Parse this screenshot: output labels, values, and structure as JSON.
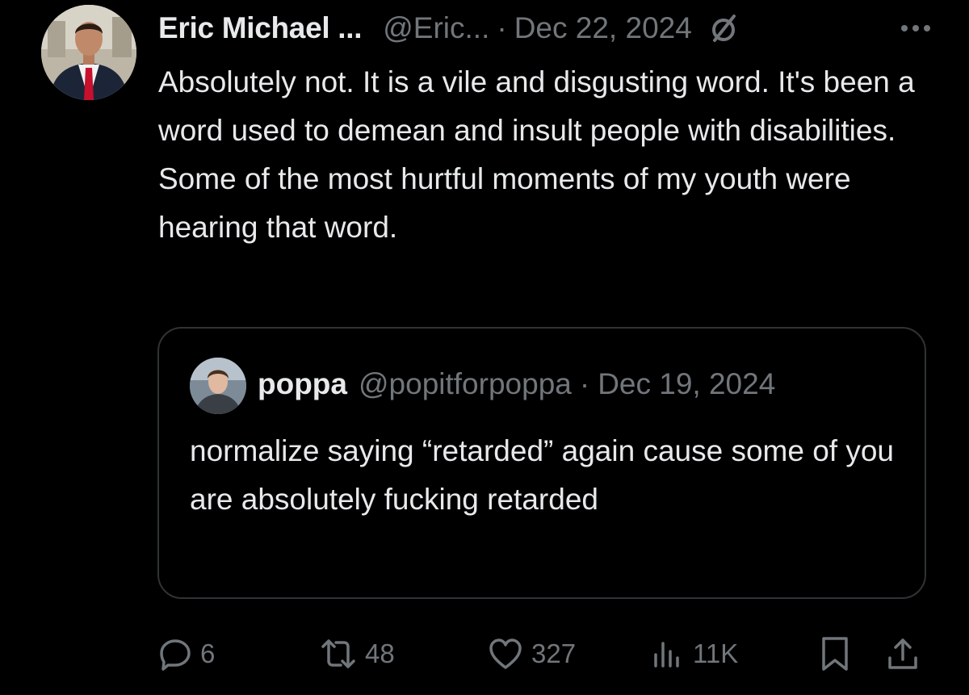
{
  "post": {
    "author": {
      "name": "Eric Michael ...",
      "handle": "@Eric...",
      "avatar_icon": "profile-photo"
    },
    "separator": "·",
    "date": "Dec 22, 2024",
    "body": "Absolutely not. It is a vile and disgusting word. It's been a word used to demean and insult people with disabilities. Some of the most hurtful moments of my youth were hearing that word.",
    "quote": {
      "author": {
        "name": "poppa",
        "handle": "@popitforpoppa",
        "avatar_icon": "profile-photo"
      },
      "separator": "·",
      "date": "Dec 19, 2024",
      "text": "normalize saying “retarded” again cause some of you are absolutely fucking retarded"
    },
    "metrics": {
      "replies": "6",
      "reposts": "48",
      "likes": "327",
      "views": "11K"
    }
  },
  "icons": {
    "grok": "slashed-circle-icon",
    "more": "more-icon",
    "reply": "reply-icon",
    "repost": "repost-icon",
    "like": "heart-icon",
    "views": "views-icon",
    "bookmark": "bookmark-icon",
    "share": "share-icon"
  },
  "colors": {
    "background": "#000000",
    "primary_text": "#e7e9ea",
    "secondary_text": "#71767b",
    "border": "#2f3336"
  }
}
